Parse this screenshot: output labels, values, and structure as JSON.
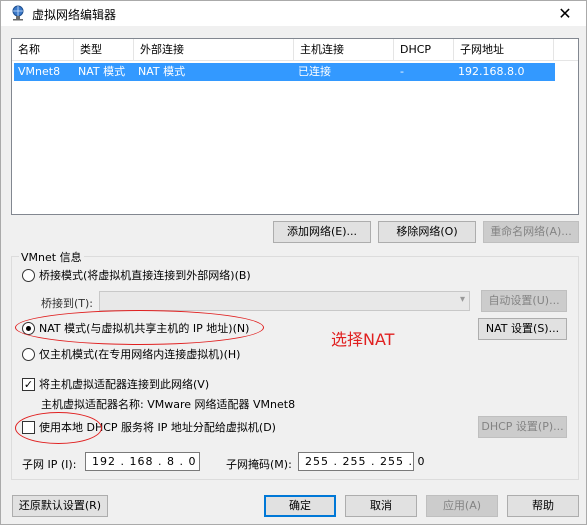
{
  "window": {
    "title": "虚拟网络编辑器",
    "close_glyph": "✕",
    "icon": "network-globe-icon"
  },
  "table": {
    "columns": [
      "名称",
      "类型",
      "外部连接",
      "主机连接",
      "DHCP",
      "子网地址"
    ],
    "rows": [
      [
        "VMnet8",
        "NAT 模式",
        "NAT 模式",
        "已连接",
        "-",
        "192.168.8.0"
      ]
    ],
    "selection_color": "#3399ff"
  },
  "table_buttons": {
    "add": "添加网络(E)...",
    "remove": "移除网络(O)",
    "rename": "重命名网络(A)..."
  },
  "vmnet_info": {
    "group_label": "VMnet 信息",
    "bridged_label": "桥接模式(将虚拟机直接连接到外部网络)(B)",
    "bridge_to_label": "桥接到(T):",
    "bridge_to_value": "",
    "auto_settings": "自动设置(U)...",
    "nat_label": "NAT 模式(与虚拟机共享主机的 IP 地址)(N)",
    "nat_settings": "NAT 设置(S)...",
    "hostonly_label": "仅主机模式(在专用网络内连接虚拟机)(H)",
    "connect_adapter_label": "将主机虚拟适配器连接到此网络(V)",
    "connect_adapter_checked": true,
    "adapter_name_text": "主机虚拟适配器名称: VMware 网络适配器 VMnet8",
    "dhcp_label": "使用本地 DHCP 服务将 IP 地址分配给虚拟机(D)",
    "dhcp_checked": false,
    "dhcp_settings": "DHCP 设置(P)...",
    "subnet_ip_label": "子网 IP (I):",
    "subnet_ip_value": "192 . 168 . 8  . 0",
    "subnet_mask_label": "子网掩码(M):",
    "subnet_mask_value": "255 . 255 . 255 . 0",
    "selected_mode": "nat"
  },
  "footer": {
    "restore_defaults": "还原默认设置(R)",
    "ok": "确定",
    "cancel": "取消",
    "apply": "应用(A)",
    "help": "帮助"
  },
  "annotation": {
    "text": "选择NAT",
    "color": "#e02020"
  }
}
